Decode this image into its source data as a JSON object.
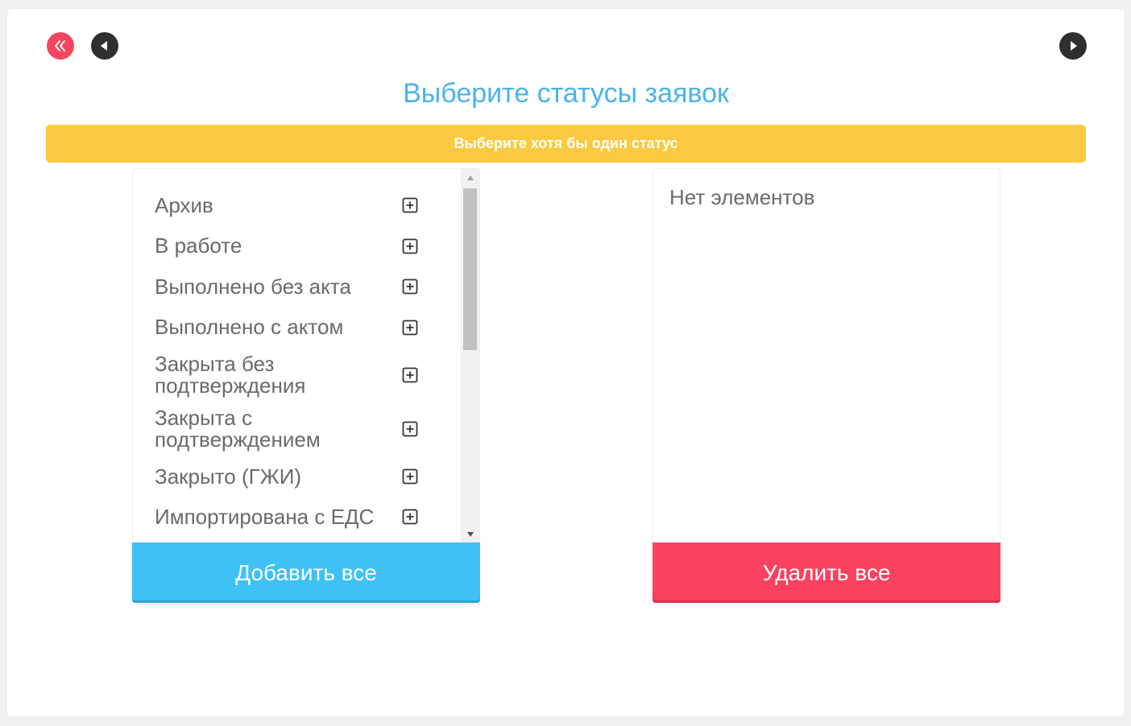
{
  "nav": {
    "first_icon": "double-chevron-left-icon",
    "prev_icon": "play-left-icon",
    "next_icon": "play-right-icon"
  },
  "title": "Выберите статусы заявок",
  "warning": "Выберите хотя бы один статус",
  "available": {
    "items": [
      {
        "label": "Архив"
      },
      {
        "label": "В работе"
      },
      {
        "label": "Выполнено без акта"
      },
      {
        "label": "Выполнено с актом"
      },
      {
        "label": "Закрыта без подтверждения"
      },
      {
        "label": "Закрыта с подтверждением"
      },
      {
        "label": "Закрыто (ГЖИ)"
      },
      {
        "label": "Импортирована с ЕДС"
      }
    ],
    "add_all_label": "Добавить все"
  },
  "selected": {
    "empty_label": "Нет элементов",
    "remove_all_label": "Удалить все"
  },
  "colors": {
    "accent_blue": "#3fc1f5",
    "danger_red": "#fb4160",
    "warning_yellow": "#fbc942",
    "title_blue": "#4ab4e8"
  }
}
